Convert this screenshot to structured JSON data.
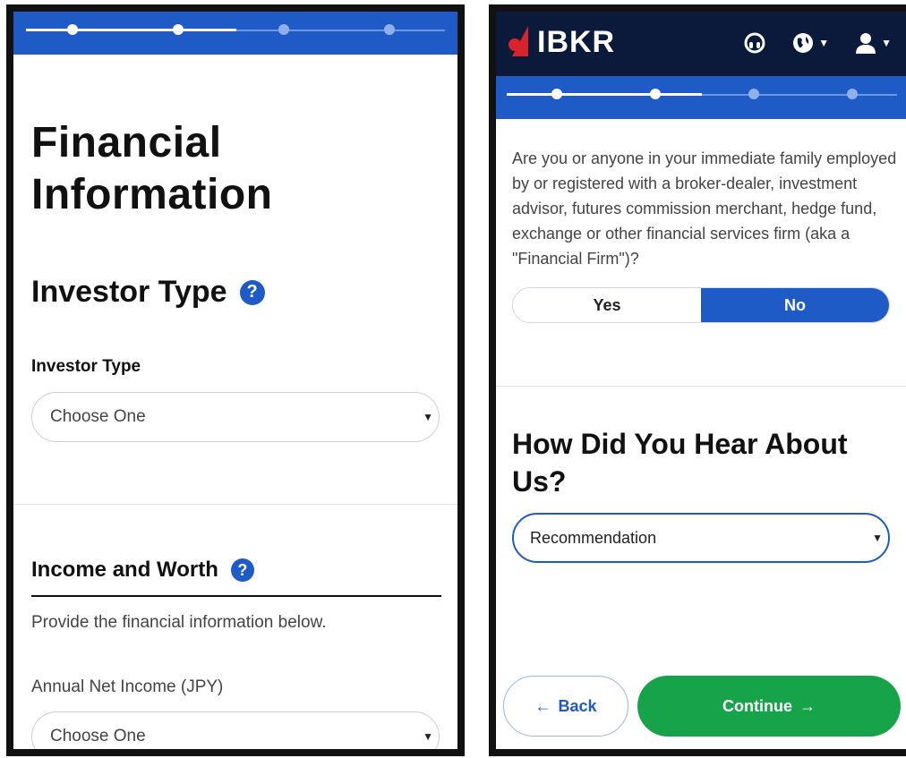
{
  "left": {
    "stepper": {
      "total_steps": 4,
      "completed_steps": 2
    },
    "page_title_line1": "Financial",
    "page_title_line2": "Information",
    "investor_section_title": "Investor Type",
    "investor_field_label": "Investor Type",
    "investor_select_value": "Choose One",
    "income_section_title": "Income and Worth",
    "income_description": "Provide the financial information below.",
    "annual_income_label": "Annual Net Income (JPY)",
    "annual_income_value": "Choose One"
  },
  "right": {
    "logo_text": "IBKR",
    "header_icons": [
      "support-headset-icon",
      "globe-icon",
      "user-icon"
    ],
    "stepper": {
      "total_steps": 4,
      "completed_steps": 2
    },
    "question": "Are you or anyone in your immediate family employed by or registered with a broker-dealer, investment advisor, futures commission merchant, hedge fund, exchange or other financial services firm (aka a \"Financial Firm\")?",
    "toggle_yes": "Yes",
    "toggle_no": "No",
    "toggle_selected": "No",
    "hear_title": "How Did You Hear About Us?",
    "hear_select_value": "Recommendation",
    "back_label": "Back",
    "continue_label": "Continue"
  },
  "colors": {
    "brand_blue": "#1e5bc6",
    "header_navy": "#0b1a3b",
    "logo_red": "#d8232a",
    "continue_green": "#16a349"
  }
}
